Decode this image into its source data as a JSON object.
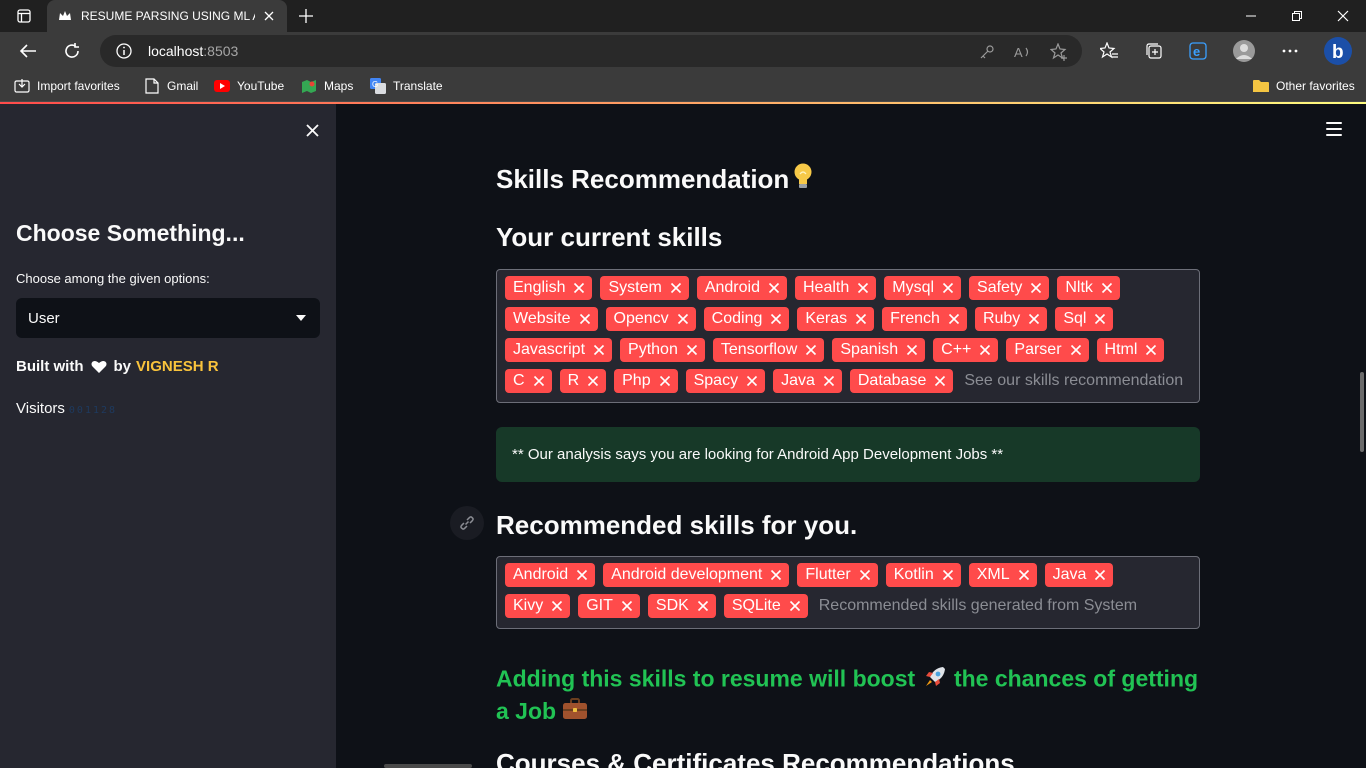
{
  "browser": {
    "tab_title": "RESUME PARSING USING ML AN",
    "url_host": "localhost",
    "url_port": ":8503",
    "favorites": [
      {
        "label": "Import favorites",
        "icon": "import-icon"
      },
      {
        "label": "Gmail",
        "icon": "page-icon"
      },
      {
        "label": "YouTube",
        "icon": "youtube-icon"
      },
      {
        "label": "Maps",
        "icon": "maps-icon"
      },
      {
        "label": "Translate",
        "icon": "translate-icon"
      }
    ],
    "other_favorites": "Other favorites"
  },
  "sidebar": {
    "heading": "Choose Something...",
    "select_label": "Choose among the given options:",
    "select_value": "User",
    "built_with": "Built with",
    "by": "by",
    "author": "VIGNESH R",
    "visitors_label": "Visitors",
    "visitors_count": "001128"
  },
  "main": {
    "skills_heading": "Skills Recommendation",
    "current_heading": "Your current skills",
    "current_skills": [
      "English",
      "System",
      "Android",
      "Health",
      "Mysql",
      "Safety",
      "Nltk",
      "Website",
      "Opencv",
      "Coding",
      "Keras",
      "French",
      "Ruby",
      "Sql",
      "Javascript",
      "Python",
      "Tensorflow",
      "Spanish",
      "C++",
      "Parser",
      "Html",
      "C",
      "R",
      "Php",
      "Spacy",
      "Java",
      "Database"
    ],
    "current_placeholder": "See our skills recommendation",
    "analysis": "** Our analysis says you are looking for Android App Development Jobs **",
    "recommended_heading": "Recommended skills for you.",
    "recommended_skills": [
      "Android",
      "Android development",
      "Flutter",
      "Kotlin",
      "XML",
      "Java",
      "Kivy",
      "GIT",
      "SDK",
      "SQLite"
    ],
    "recommended_placeholder": "Recommended skills generated from System",
    "boost_text_1": "Adding this skills to resume will boost",
    "boost_text_2": "the chances of getting a Job",
    "courses_heading": "Courses & Certificates Recommendations"
  },
  "colors": {
    "tag": "#ff4b4b",
    "boost": "#21c354",
    "author": "#f9c33c",
    "alert_bg": "#173928"
  }
}
